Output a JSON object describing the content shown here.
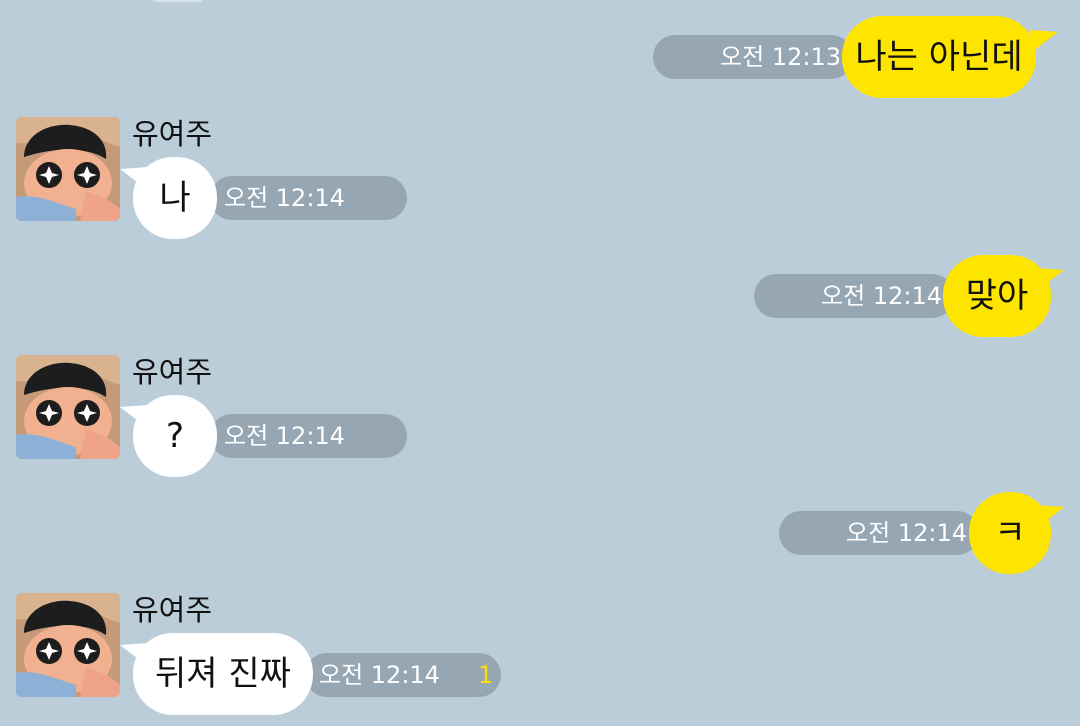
{
  "chat": {
    "messages": [
      {
        "from": "me",
        "text": "나는 아닌데",
        "time": "오전 12:13"
      },
      {
        "from": "other",
        "sender": "유여주",
        "text": "나",
        "time": "오전 12:14"
      },
      {
        "from": "me",
        "text": "맞아",
        "time": "오전 12:14"
      },
      {
        "from": "other",
        "sender": "유여주",
        "text": "?",
        "time": "오전 12:14"
      },
      {
        "from": "me",
        "text": "ㅋ",
        "time": "오전 12:14"
      },
      {
        "from": "other",
        "sender": "유여주",
        "text": "뒤져 진짜",
        "time": "오전 12:14",
        "unread": "1"
      }
    ]
  },
  "colors": {
    "background": "#bacdd9",
    "my_bubble": "#fee500",
    "other_bubble": "#ffffff",
    "time_pill": "#96a6b2",
    "unread": "#fae100"
  },
  "icons": {
    "avatar": "cartoon-avatar-icon"
  }
}
